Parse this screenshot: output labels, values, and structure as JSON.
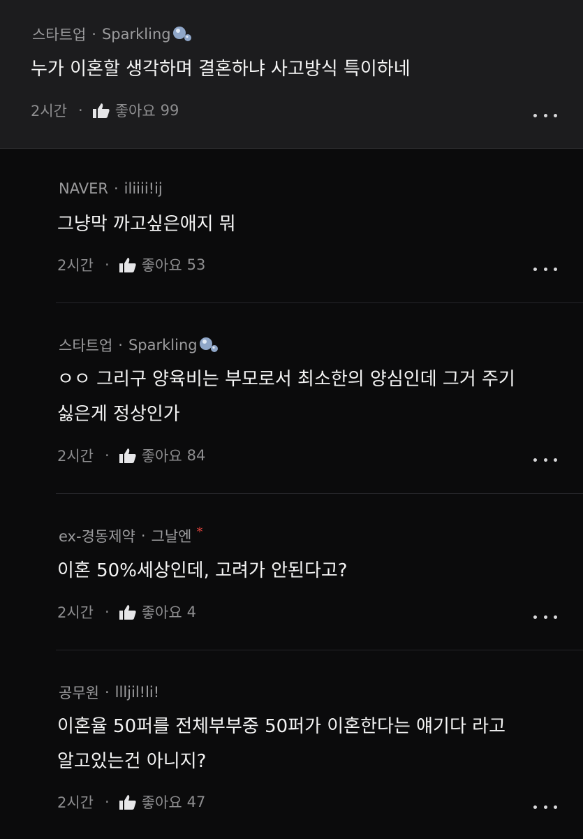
{
  "comments": [
    {
      "author_group": "스타트업",
      "author": "Sparkling",
      "text_lines": [
        "누가 이혼할 생각하며 결혼하냐 사고방식 특이하네"
      ],
      "time": "2시간",
      "like_label": "좋아요",
      "likes": "99"
    },
    {
      "author_group": "NAVER",
      "author": "iliiii!ij",
      "text_lines": [
        "그냥막 까고싶은애지 뭐"
      ],
      "time": "2시간",
      "like_label": "좋아요",
      "likes": "53"
    },
    {
      "author_group": "스타트업",
      "author": "Sparkling",
      "text_lines": [
        "ㅇㅇ 그리구 양육비는 부모로서 최소한의 양심인데 그거 주기",
        "싫은게 정상인가"
      ],
      "time": "2시간",
      "like_label": "좋아요",
      "likes": "84"
    },
    {
      "author_group": "ex-경동제약",
      "author": "그날엔",
      "star": "*",
      "text_lines": [
        "이혼 50%세상인데, 고려가 안된다고?"
      ],
      "time": "2시간",
      "like_label": "좋아요",
      "likes": "4"
    },
    {
      "author_group": "공무원",
      "author": "llljil!li!",
      "text_lines": [
        "이혼율 50퍼를 전체부부중 50퍼가 이혼한다는 얘기다 라고",
        "알고있는건 아니지?"
      ],
      "time": "2시간",
      "like_label": "좋아요",
      "likes": "47"
    }
  ],
  "separator": "·",
  "icons": {
    "like": "thumbs-up-icon",
    "more": "more-horizontal-icon",
    "badge": "bubbles-icon"
  },
  "colors": {
    "badge": "#8fa6c8",
    "star": "#e0433c"
  }
}
